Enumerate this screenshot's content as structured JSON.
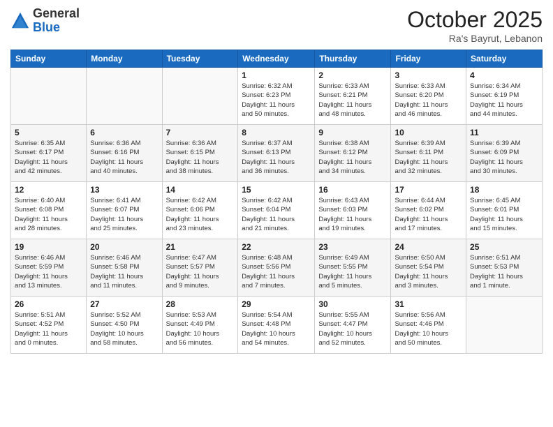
{
  "header": {
    "logo_general": "General",
    "logo_blue": "Blue",
    "month_title": "October 2025",
    "location": "Ra's Bayrut, Lebanon"
  },
  "days_of_week": [
    "Sunday",
    "Monday",
    "Tuesday",
    "Wednesday",
    "Thursday",
    "Friday",
    "Saturday"
  ],
  "weeks": [
    [
      {
        "day": "",
        "info": ""
      },
      {
        "day": "",
        "info": ""
      },
      {
        "day": "",
        "info": ""
      },
      {
        "day": "1",
        "info": "Sunrise: 6:32 AM\nSunset: 6:23 PM\nDaylight: 11 hours\nand 50 minutes."
      },
      {
        "day": "2",
        "info": "Sunrise: 6:33 AM\nSunset: 6:21 PM\nDaylight: 11 hours\nand 48 minutes."
      },
      {
        "day": "3",
        "info": "Sunrise: 6:33 AM\nSunset: 6:20 PM\nDaylight: 11 hours\nand 46 minutes."
      },
      {
        "day": "4",
        "info": "Sunrise: 6:34 AM\nSunset: 6:19 PM\nDaylight: 11 hours\nand 44 minutes."
      }
    ],
    [
      {
        "day": "5",
        "info": "Sunrise: 6:35 AM\nSunset: 6:17 PM\nDaylight: 11 hours\nand 42 minutes."
      },
      {
        "day": "6",
        "info": "Sunrise: 6:36 AM\nSunset: 6:16 PM\nDaylight: 11 hours\nand 40 minutes."
      },
      {
        "day": "7",
        "info": "Sunrise: 6:36 AM\nSunset: 6:15 PM\nDaylight: 11 hours\nand 38 minutes."
      },
      {
        "day": "8",
        "info": "Sunrise: 6:37 AM\nSunset: 6:13 PM\nDaylight: 11 hours\nand 36 minutes."
      },
      {
        "day": "9",
        "info": "Sunrise: 6:38 AM\nSunset: 6:12 PM\nDaylight: 11 hours\nand 34 minutes."
      },
      {
        "day": "10",
        "info": "Sunrise: 6:39 AM\nSunset: 6:11 PM\nDaylight: 11 hours\nand 32 minutes."
      },
      {
        "day": "11",
        "info": "Sunrise: 6:39 AM\nSunset: 6:09 PM\nDaylight: 11 hours\nand 30 minutes."
      }
    ],
    [
      {
        "day": "12",
        "info": "Sunrise: 6:40 AM\nSunset: 6:08 PM\nDaylight: 11 hours\nand 28 minutes."
      },
      {
        "day": "13",
        "info": "Sunrise: 6:41 AM\nSunset: 6:07 PM\nDaylight: 11 hours\nand 25 minutes."
      },
      {
        "day": "14",
        "info": "Sunrise: 6:42 AM\nSunset: 6:06 PM\nDaylight: 11 hours\nand 23 minutes."
      },
      {
        "day": "15",
        "info": "Sunrise: 6:42 AM\nSunset: 6:04 PM\nDaylight: 11 hours\nand 21 minutes."
      },
      {
        "day": "16",
        "info": "Sunrise: 6:43 AM\nSunset: 6:03 PM\nDaylight: 11 hours\nand 19 minutes."
      },
      {
        "day": "17",
        "info": "Sunrise: 6:44 AM\nSunset: 6:02 PM\nDaylight: 11 hours\nand 17 minutes."
      },
      {
        "day": "18",
        "info": "Sunrise: 6:45 AM\nSunset: 6:01 PM\nDaylight: 11 hours\nand 15 minutes."
      }
    ],
    [
      {
        "day": "19",
        "info": "Sunrise: 6:46 AM\nSunset: 5:59 PM\nDaylight: 11 hours\nand 13 minutes."
      },
      {
        "day": "20",
        "info": "Sunrise: 6:46 AM\nSunset: 5:58 PM\nDaylight: 11 hours\nand 11 minutes."
      },
      {
        "day": "21",
        "info": "Sunrise: 6:47 AM\nSunset: 5:57 PM\nDaylight: 11 hours\nand 9 minutes."
      },
      {
        "day": "22",
        "info": "Sunrise: 6:48 AM\nSunset: 5:56 PM\nDaylight: 11 hours\nand 7 minutes."
      },
      {
        "day": "23",
        "info": "Sunrise: 6:49 AM\nSunset: 5:55 PM\nDaylight: 11 hours\nand 5 minutes."
      },
      {
        "day": "24",
        "info": "Sunrise: 6:50 AM\nSunset: 5:54 PM\nDaylight: 11 hours\nand 3 minutes."
      },
      {
        "day": "25",
        "info": "Sunrise: 6:51 AM\nSunset: 5:53 PM\nDaylight: 11 hours\nand 1 minute."
      }
    ],
    [
      {
        "day": "26",
        "info": "Sunrise: 5:51 AM\nSunset: 4:52 PM\nDaylight: 11 hours\nand 0 minutes."
      },
      {
        "day": "27",
        "info": "Sunrise: 5:52 AM\nSunset: 4:50 PM\nDaylight: 10 hours\nand 58 minutes."
      },
      {
        "day": "28",
        "info": "Sunrise: 5:53 AM\nSunset: 4:49 PM\nDaylight: 10 hours\nand 56 minutes."
      },
      {
        "day": "29",
        "info": "Sunrise: 5:54 AM\nSunset: 4:48 PM\nDaylight: 10 hours\nand 54 minutes."
      },
      {
        "day": "30",
        "info": "Sunrise: 5:55 AM\nSunset: 4:47 PM\nDaylight: 10 hours\nand 52 minutes."
      },
      {
        "day": "31",
        "info": "Sunrise: 5:56 AM\nSunset: 4:46 PM\nDaylight: 10 hours\nand 50 minutes."
      },
      {
        "day": "",
        "info": ""
      }
    ]
  ]
}
